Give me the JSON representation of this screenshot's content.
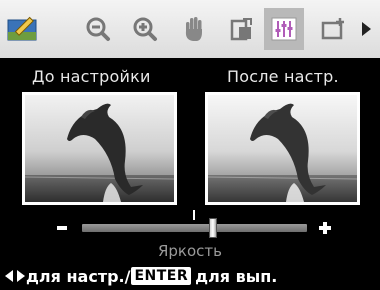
{
  "toolbar": {
    "items": [
      {
        "icon": "edit-photo-icon",
        "selected": false
      },
      {
        "icon": "zoom-out-icon",
        "selected": false
      },
      {
        "icon": "zoom-in-icon",
        "selected": false
      },
      {
        "icon": "hand-pan-icon",
        "selected": false
      },
      {
        "icon": "rotate-icon",
        "selected": false
      },
      {
        "icon": "adjust-icon",
        "selected": true
      },
      {
        "icon": "frame-icon",
        "selected": false
      },
      {
        "icon": "scroll-right-arrow-icon",
        "selected": false
      }
    ]
  },
  "preview": {
    "before_label": "До настройки",
    "after_label": "После настр."
  },
  "slider": {
    "label": "Яркость",
    "min_symbol": "–",
    "max_symbol": "+",
    "value_fraction": 0.58
  },
  "footer": {
    "adjust_text": "для настр./",
    "enter_key": "ENTER",
    "execute_text": "для вып."
  },
  "colors": {
    "background": "#000000",
    "toolbar": "#e8e8e8",
    "selected_tab": "#b9b9b9",
    "slider_label": "#9a9a9a"
  }
}
